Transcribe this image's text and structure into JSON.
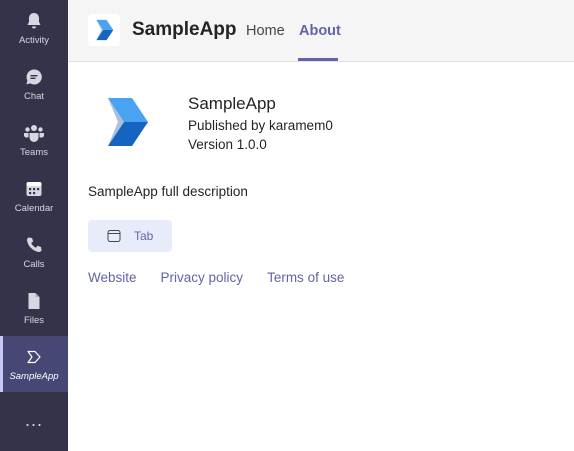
{
  "rail": {
    "items": [
      {
        "label": "Activity",
        "icon": "bell-icon"
      },
      {
        "label": "Chat",
        "icon": "chat-icon"
      },
      {
        "label": "Teams",
        "icon": "teams-icon"
      },
      {
        "label": "Calendar",
        "icon": "calendar-icon"
      },
      {
        "label": "Calls",
        "icon": "phone-icon"
      },
      {
        "label": "Files",
        "icon": "file-icon"
      },
      {
        "label": "SampleApp",
        "icon": "sampleapp-icon",
        "active": true
      }
    ],
    "more": "..."
  },
  "header": {
    "title": "SampleApp",
    "tabs": [
      {
        "label": "Home",
        "selected": false
      },
      {
        "label": "About",
        "selected": true
      }
    ]
  },
  "about": {
    "app_name": "SampleApp",
    "publisher": "Published by karamem0",
    "version": "Version 1.0.0",
    "description": "SampleApp full description",
    "capability": "Tab",
    "links": [
      "Website",
      "Privacy policy",
      "Terms of use"
    ]
  },
  "colors": {
    "rail_bg": "#33344a",
    "rail_active": "#464775",
    "accent": "#6264a7",
    "chip_bg": "#e8ebfa",
    "logo_blue": "#1e88e5"
  }
}
